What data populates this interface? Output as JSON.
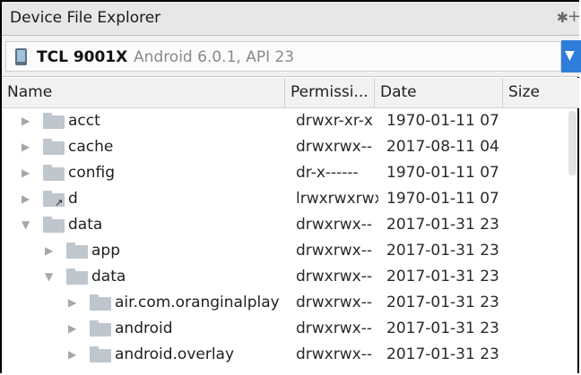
{
  "window": {
    "title": "Device File Explorer"
  },
  "device": {
    "name": "TCL 9001X",
    "info": "Android 6.0.1, API 23"
  },
  "columns": {
    "name": "Name",
    "permissions": "Permissi...",
    "date": "Date",
    "size": "Size"
  },
  "rows": [
    {
      "name": "acct",
      "perm": "drwxr-xr-x",
      "date": "1970-01-11 07",
      "level": 0,
      "state": "collapsed",
      "link": false
    },
    {
      "name": "cache",
      "perm": "drwxrwx--",
      "date": "2017-08-11 04",
      "level": 0,
      "state": "collapsed",
      "link": false
    },
    {
      "name": "config",
      "perm": "dr-x------",
      "date": "1970-01-11 07",
      "level": 0,
      "state": "collapsed",
      "link": false
    },
    {
      "name": "d",
      "perm": "lrwxrwxrwx",
      "date": "1970-01-11 07",
      "level": 0,
      "state": "collapsed",
      "link": true
    },
    {
      "name": "data",
      "perm": "drwxrwx--",
      "date": "2017-01-31 23",
      "level": 0,
      "state": "expanded",
      "link": false
    },
    {
      "name": "app",
      "perm": "drwxrwx--",
      "date": "2017-01-31 23",
      "level": 1,
      "state": "collapsed",
      "link": false
    },
    {
      "name": "data",
      "perm": "drwxrwx--",
      "date": "2017-01-31 23",
      "level": 1,
      "state": "expanded",
      "link": false
    },
    {
      "name": "air.com.oranginalplay",
      "perm": "drwxrwx--",
      "date": "2017-01-31 23",
      "level": 2,
      "state": "collapsed",
      "link": false
    },
    {
      "name": "android",
      "perm": "drwxrwx--",
      "date": "2017-01-31 23",
      "level": 2,
      "state": "collapsed",
      "link": false
    },
    {
      "name": "android.overlay",
      "perm": "drwxrwx--",
      "date": "2017-01-31 23",
      "level": 2,
      "state": "collapsed",
      "link": false
    }
  ],
  "icons": {
    "settings": "gear-icon",
    "more": "plus-icon",
    "device": "phone-icon",
    "dropdown": "chevron-down-icon"
  },
  "colors": {
    "accent": "#2f7ddb",
    "folder": "#bfc6cd"
  }
}
